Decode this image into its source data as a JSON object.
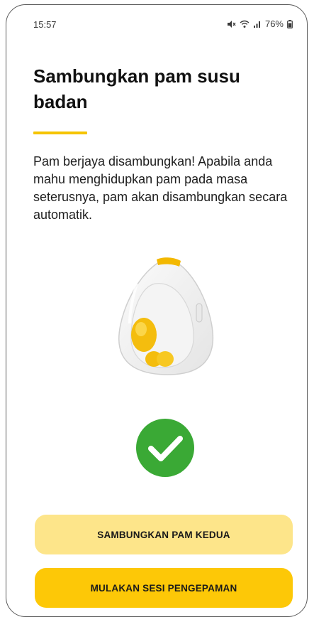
{
  "status_bar": {
    "time": "15:57",
    "battery": "76%"
  },
  "screen": {
    "title": "Sambungkan pam susu badan",
    "description": "Pam berjaya disambungkan! Apabila anda mahu menghidupkan pam pada masa seterusnya, pam akan disambungkan secara automatik."
  },
  "buttons": {
    "secondary_label": "SAMBUNGKAN PAM KEDUA",
    "primary_label": "MULAKAN SESI PENGEPAMAN"
  },
  "colors": {
    "accent": "#f5c400",
    "primary_button": "#fdc807",
    "secondary_button": "#fde58a",
    "success": "#3aa935"
  },
  "icons": [
    "mute-icon",
    "wifi-icon",
    "signal-icon",
    "battery-icon",
    "pump-device-image",
    "check-circle-icon"
  ]
}
